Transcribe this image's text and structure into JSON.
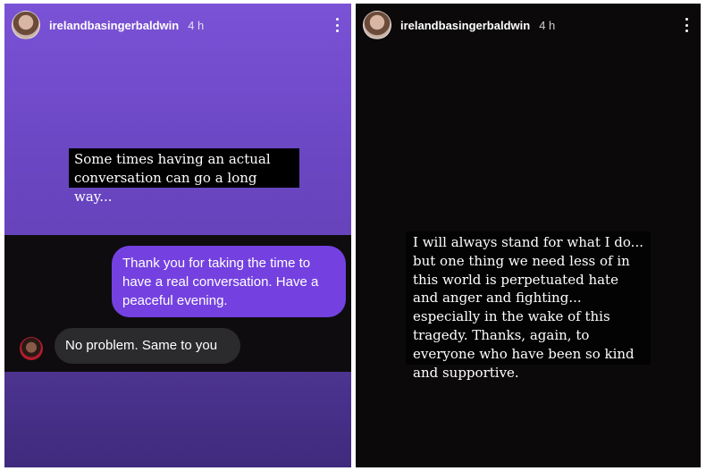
{
  "left_story": {
    "username": "irelandbasingerbaldwin",
    "time": "4 h",
    "caption": "Some times having an actual conversation can go a long way...",
    "sent_message": "Thank you for taking the time to have a real conversation. Have a peaceful evening.",
    "received_message": "No problem. Same to you",
    "background_color": "#6a46c2",
    "sent_bubble_color": "#7441e0"
  },
  "right_story": {
    "username": "irelandbasingerbaldwin",
    "time": "4 h",
    "caption": "I will always stand for what I do... but one thing we need less of in this world is perpetuated hate and anger and fighting... especially in the wake of this tragedy. Thanks, again, to everyone who have been so kind and supportive.",
    "background_color": "#0b0909"
  },
  "icons": [
    "avatar",
    "more-options-icon"
  ]
}
